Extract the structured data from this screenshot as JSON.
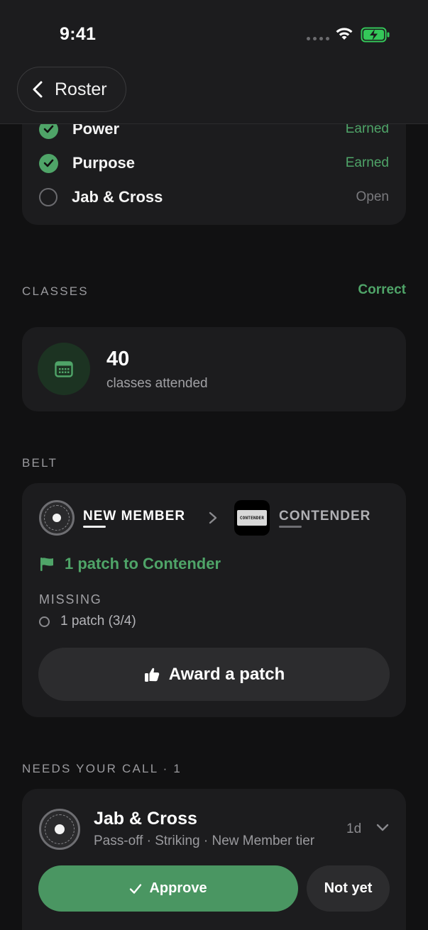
{
  "status_bar": {
    "time": "9:41"
  },
  "nav": {
    "back_label": "Roster"
  },
  "patches": [
    {
      "name": "Power",
      "status": "Earned",
      "earned": true
    },
    {
      "name": "Purpose",
      "status": "Earned",
      "earned": true
    },
    {
      "name": "Jab & Cross",
      "status": "Open",
      "earned": false
    }
  ],
  "classes": {
    "section_label": "CLASSES",
    "action_label": "Correct",
    "count": "40",
    "caption": "classes attended"
  },
  "belt": {
    "section_label": "BELT",
    "current_tier": "NEW MEMBER",
    "next_tier": "CONTENDER",
    "next_tier_badge_text": "CONTENDER",
    "progress_text": "1 patch to Contender",
    "missing_label": "MISSING",
    "missing_items": [
      "1 patch (3/4)"
    ],
    "award_label": "Award a patch"
  },
  "needs_call": {
    "section_label": "NEEDS YOUR CALL · 1",
    "item": {
      "title": "Jab & Cross",
      "subtitle": "Pass-off · Striking · New Member tier",
      "age": "1d",
      "approve_label": "Approve",
      "reject_label": "Not yet"
    }
  },
  "colors": {
    "accent_green": "#4fa468",
    "approve_green": "#4a9662",
    "background": "#111112",
    "card": "#1c1c1e"
  }
}
